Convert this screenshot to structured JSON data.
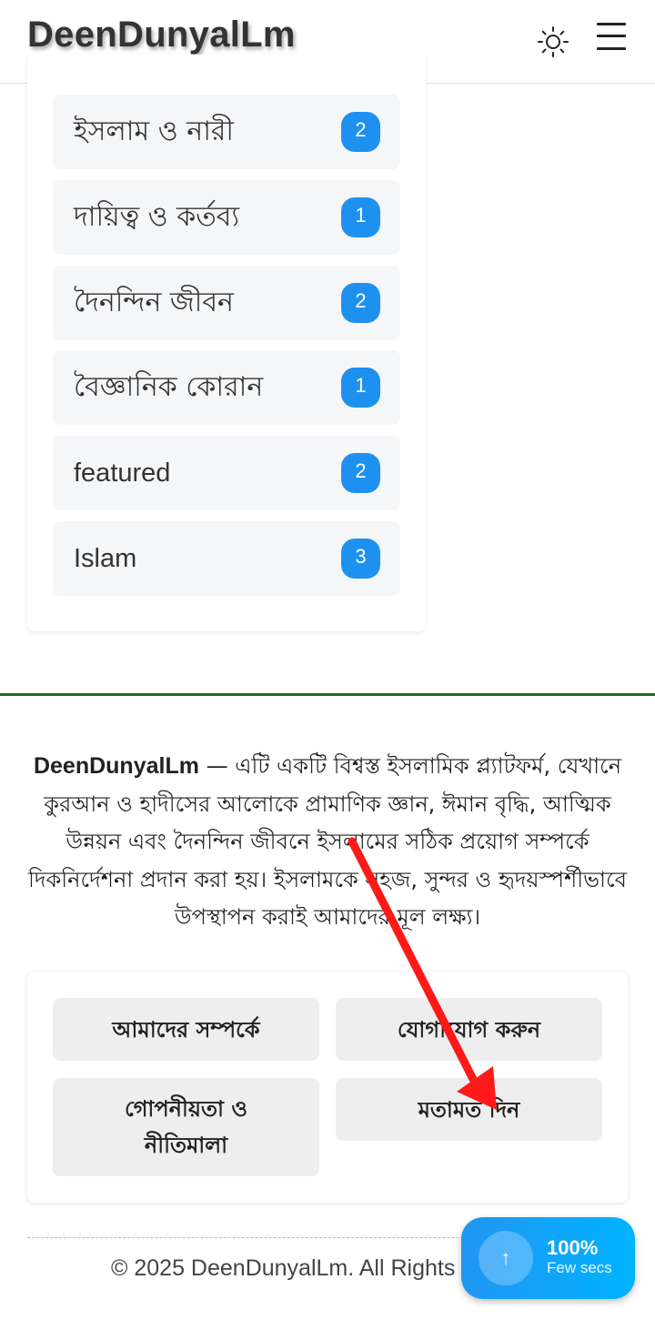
{
  "header": {
    "logo": "DeenDunyalLm",
    "theme_icon": "sun-icon",
    "menu_icon": "hamburger-menu-icon"
  },
  "tags": [
    {
      "label": "ইসলাম ও নারী",
      "count": "2"
    },
    {
      "label": "দায়িত্ব ও কর্তব্য",
      "count": "1"
    },
    {
      "label": "দৈনন্দিন জীবন",
      "count": "2"
    },
    {
      "label": "বৈজ্ঞানিক কোরান",
      "count": "1"
    },
    {
      "label": "featured",
      "count": "2"
    },
    {
      "label": "Islam",
      "count": "3"
    }
  ],
  "footer": {
    "brand": "DeenDunyalLm",
    "about": " — এটি একটি বিশ্বস্ত ইসলামিক প্ল্যাটফর্ম, যেখানে কুরআন ও হাদীসের আলোকে প্রামাণিক জ্ঞান, ঈমান বৃদ্ধি, আত্মিক উন্নয়ন এবং দৈনন্দিন জীবনে ইসলামের সঠিক প্রয়োগ সম্পর্কে দিকনির্দেশনা প্রদান করা হয়। ইসলামকে সহজ, সুন্দর ও হৃদয়স্পর্শীভাবে উপস্থাপন করাই আমাদের মূল লক্ষ্য।",
    "links": {
      "about_us": "আমাদের সম্পর্কে",
      "contact": "যোগাযোগ করুন",
      "privacy": "গোপনীয়তা ও নীতিমালা",
      "feedback": "মতামত দিন"
    },
    "copyright": "© 2025 DeenDunyalLm. All Rights Reserved."
  },
  "reading_progress": {
    "percent": "100%",
    "time_left": "Few secs",
    "scroll_icon": "arrow-up-icon"
  },
  "colors": {
    "badge": "#1e90f0",
    "divider": "#1b6b1b",
    "annotation_arrow": "#ff1a1a"
  }
}
